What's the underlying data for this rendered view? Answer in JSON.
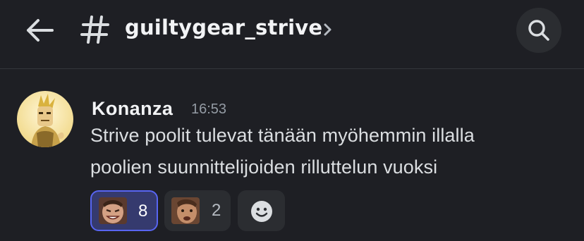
{
  "header": {
    "channel_name": "guiltygear_strive"
  },
  "message": {
    "author": "Konanza",
    "timestamp": "16:53",
    "lines": [
      "Strive poolit tulevat tänään myöhemmin illalla",
      "poolien suunnittelijoiden rilluttelun vuoksi"
    ]
  },
  "reactions": [
    {
      "count": "8",
      "active": true
    },
    {
      "count": "2",
      "active": false
    }
  ],
  "colors": {
    "background": "#1e1f24",
    "active_reaction_bg": "#353a6e",
    "active_reaction_border": "#5865f2",
    "reaction_bg": "#2b2d31",
    "muted_text": "#949ba4"
  },
  "icons": {
    "back": "arrow-left-icon",
    "channel": "hash-icon",
    "expand": "chevron-right-icon",
    "search": "search-icon",
    "add_reaction": "smile-icon"
  }
}
